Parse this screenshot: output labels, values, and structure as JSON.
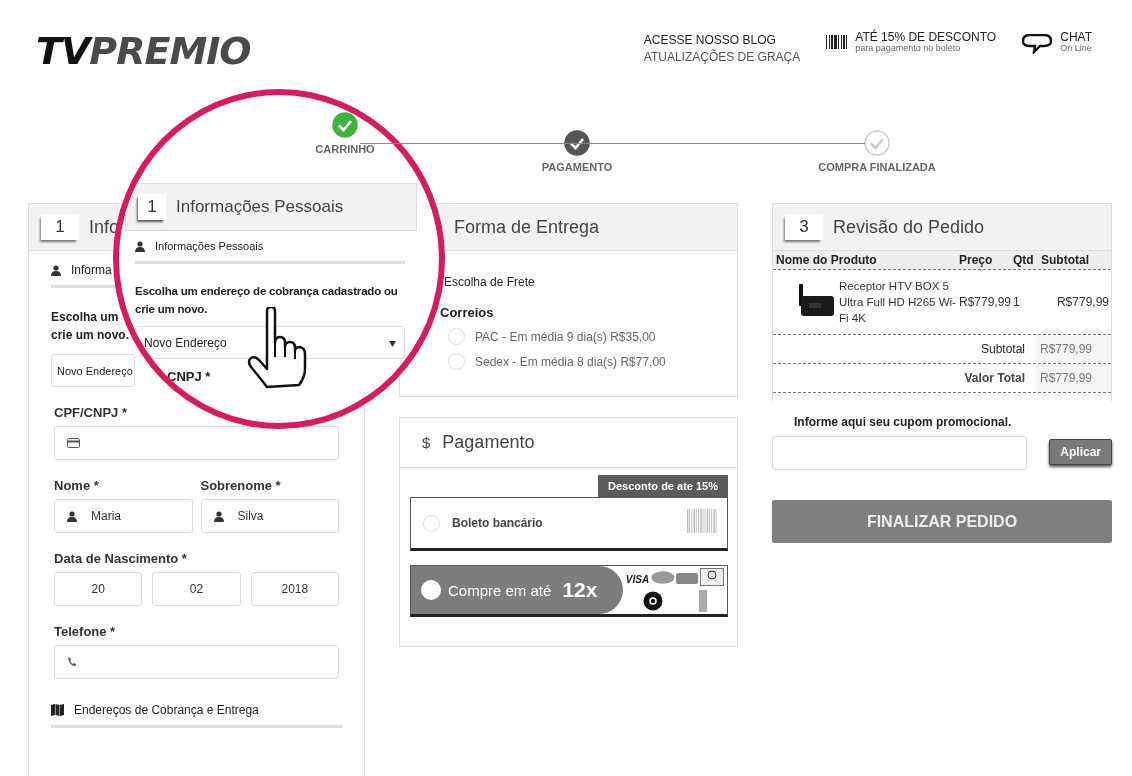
{
  "header": {
    "logo": {
      "first": "TV",
      "second": "PREMIO"
    },
    "blog": {
      "title": "ACESSE NOSSO BLOG",
      "subtitle": "ATUALIZAÇÕES DE GRAÇA"
    },
    "discount": {
      "title": "ATÉ 15% DE DESCONTO",
      "subtitle": "para pagamento no boleto"
    },
    "chat": {
      "title": "CHAT",
      "subtitle": "On Line"
    }
  },
  "steps": [
    {
      "label": "CARRINHO",
      "completed": true,
      "color": "#3fb33f"
    },
    {
      "label": "PAGAMENTO",
      "completed": true,
      "color": "#555555"
    },
    {
      "label": "COMPRA FINALIZADA",
      "completed": false,
      "color": "#ffffff"
    }
  ],
  "personal": {
    "number": "1",
    "title": "Info",
    "section": "Informa",
    "prompt": [
      "Escolha um",
      "crie um novo."
    ],
    "address_select": "Novo Endereço",
    "fields": [
      {
        "kind": "document",
        "labels": [
          "CPF/CNPJ *"
        ]
      },
      {
        "kind": "name",
        "labels": [
          "Nome *",
          "Sobrenome *"
        ],
        "values": [
          "Maria",
          "Silva"
        ]
      },
      {
        "kind": "date",
        "labels": [
          "Data de Nascimento *"
        ],
        "values": [
          "20",
          "02",
          "2018"
        ]
      },
      {
        "kind": "phone",
        "labels": [
          "Telefone *"
        ]
      }
    ],
    "address_section": "Endereços de Cobrança e Entrega"
  },
  "magnifier": {
    "number": "1",
    "title": "Informações Pessoais",
    "section": "Informações Pessoais",
    "prompt": "Escolha um endereço de cobrança cadastrado ou crie um novo.",
    "address_select": "Novo Endereço",
    "next_label": "CNPJ *"
  },
  "shipping": {
    "title": "Forma de Entrega",
    "subtitle": "Escolha de Frete",
    "carrier": "Correios",
    "options": [
      {
        "label": "PAC - Em média 9 dia(s) R$35,00",
        "selected": false
      },
      {
        "label": "Sedex - Em média 8 dia(s) R$77,00",
        "selected": false
      }
    ]
  },
  "payment": {
    "symbol": "$",
    "title": "Pagamento",
    "badge": "Desconto de ate 15%",
    "options": [
      {
        "kind": "boleto",
        "label": "Boleto bancário",
        "selected": false
      },
      {
        "kind": "card",
        "label": "Compre em até",
        "installments": "12x",
        "brand": "VISA",
        "selected": false
      }
    ]
  },
  "review": {
    "number": "3",
    "title": "Revisão do Pedido",
    "columns": [
      "Nome do Produto",
      "Preço",
      "Qtd",
      "Subtotal"
    ],
    "rows": [
      {
        "product": "Receptor HTV BOX 5 Ultra Full HD H265 Wi-Fi 4K",
        "price": "R$779,99",
        "qty": "1",
        "subtotal": "R$779,99"
      }
    ],
    "totals": [
      {
        "kind": "subtotal",
        "label": "Subtotal",
        "value": "R$779,99"
      },
      {
        "kind": "total",
        "label": "Valor Total",
        "value": "R$779,99"
      }
    ],
    "coupon_label": "Informe aqui seu cupom promocional.",
    "coupon_button": "Aplicar",
    "finish_button": "FINALIZAR PEDIDO"
  }
}
